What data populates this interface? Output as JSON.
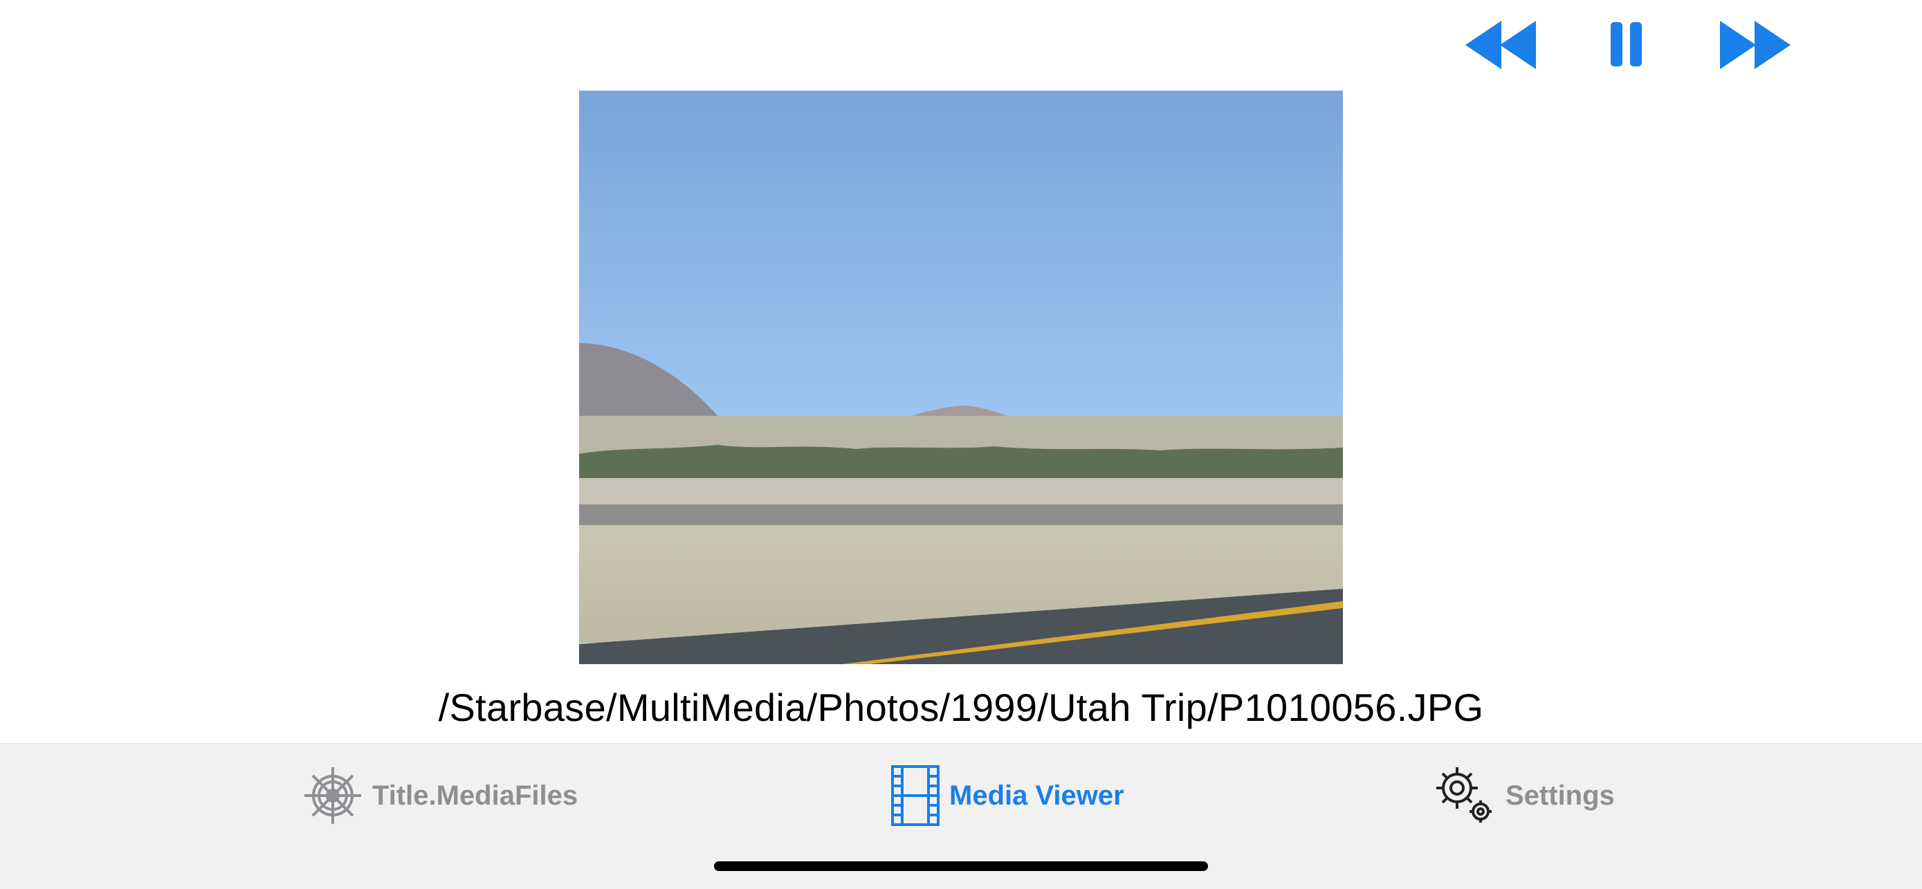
{
  "player": {
    "controls": {
      "rewind_icon": "backward-icon",
      "pause_icon": "pause-icon",
      "forward_icon": "forward-icon",
      "accent_color": "#1a7fe8"
    },
    "photo": {
      "description_icon": "landscape-photo"
    },
    "file_path": "/Starbase/MultiMedia/Photos/1999/Utah Trip/P1010056.JPG"
  },
  "tab_bar": {
    "tabs": [
      {
        "label": "Title.MediaFiles",
        "icon": "ship-wheel-icon",
        "active": false
      },
      {
        "label": "Media Viewer",
        "icon": "film-strip-icon",
        "active": true
      },
      {
        "label": "Settings",
        "icon": "gears-icon",
        "active": false
      }
    ],
    "active_color": "#1a7fe8",
    "inactive_color": "#8e8e93"
  }
}
